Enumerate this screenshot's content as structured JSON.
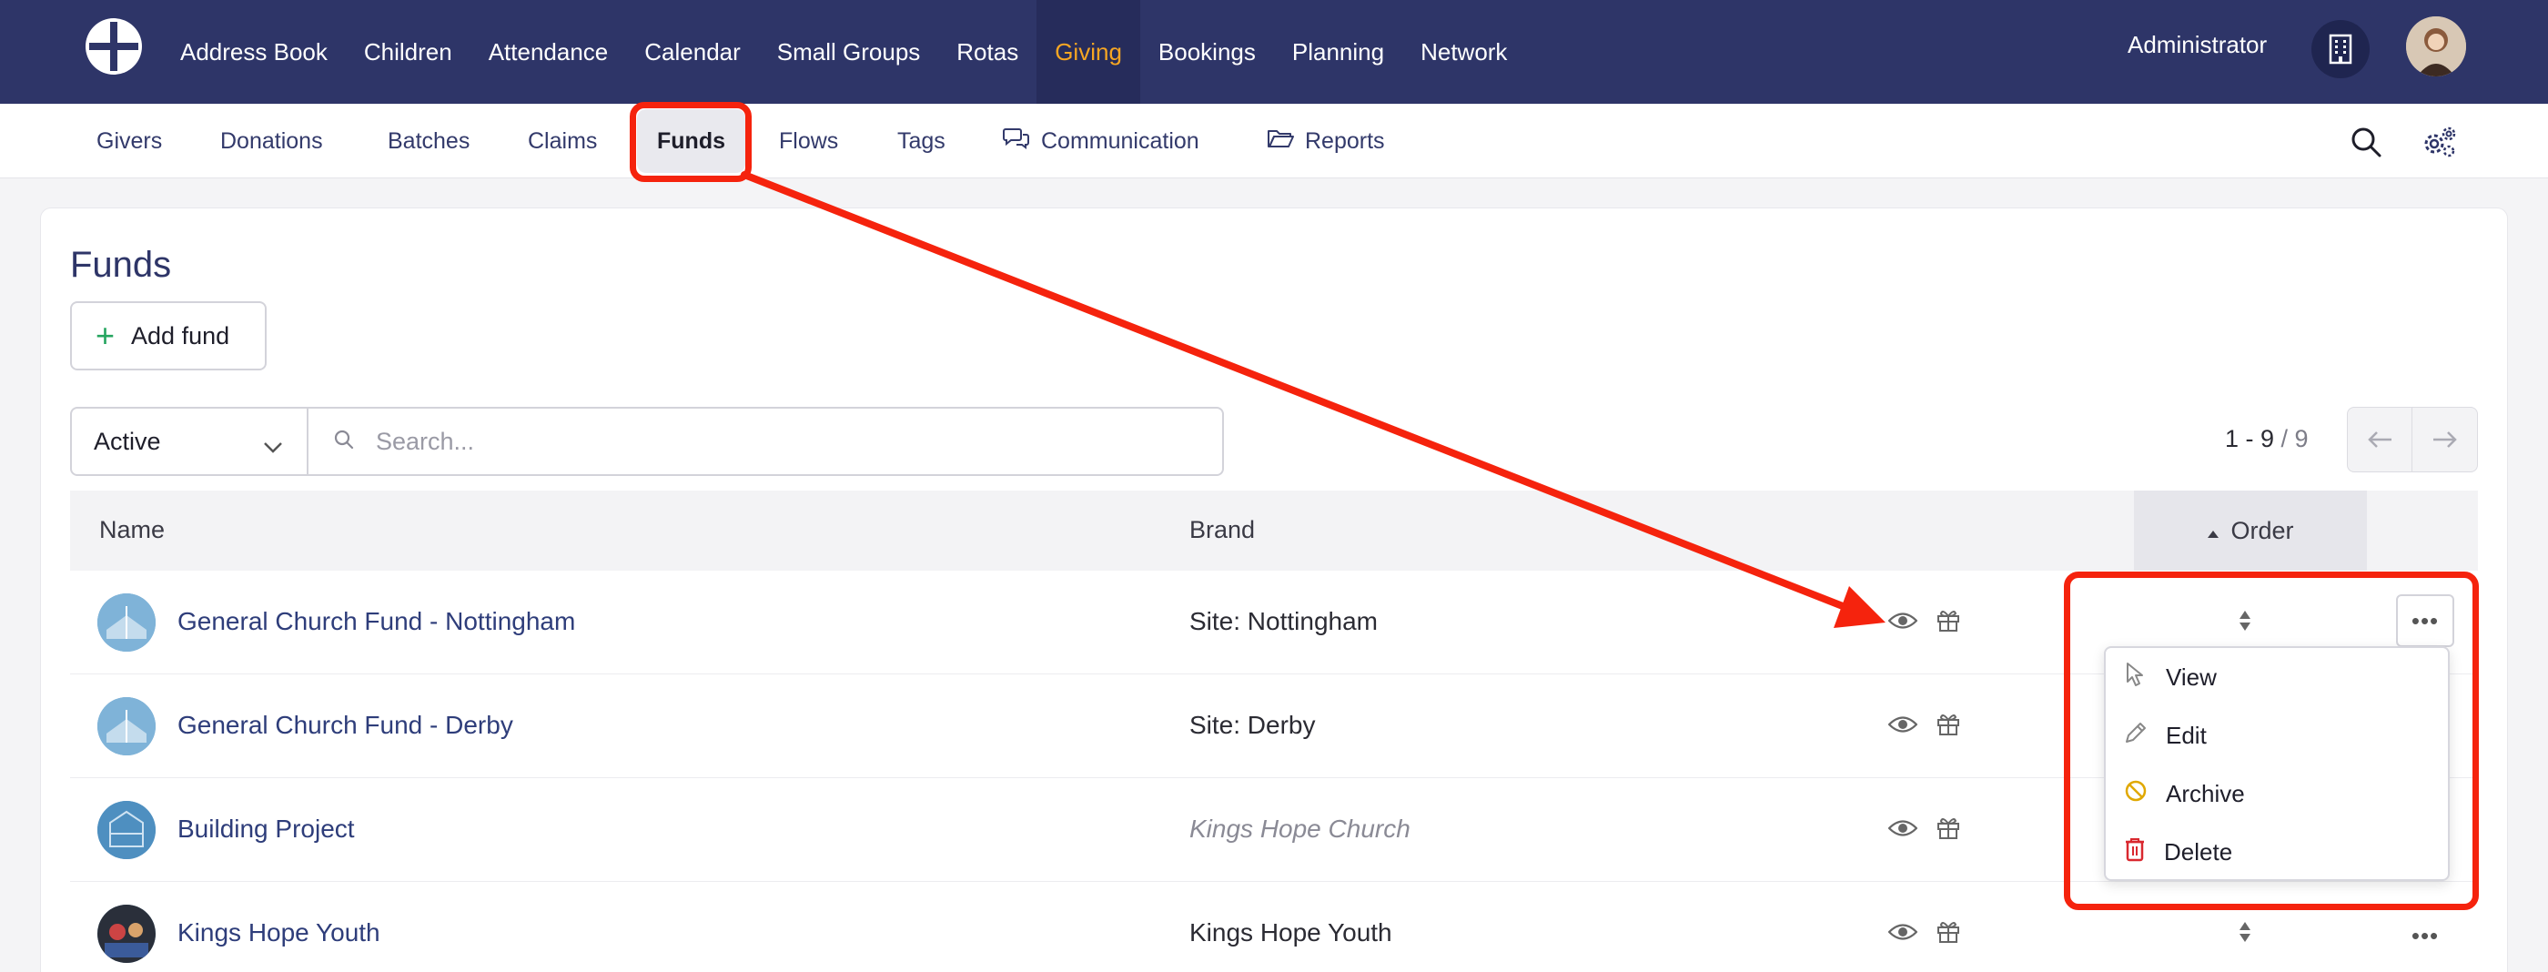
{
  "topnav": {
    "items": [
      {
        "label": "Address Book"
      },
      {
        "label": "Children"
      },
      {
        "label": "Attendance"
      },
      {
        "label": "Calendar"
      },
      {
        "label": "Small Groups"
      },
      {
        "label": "Rotas"
      },
      {
        "label": "Giving",
        "active": true
      },
      {
        "label": "Bookings"
      },
      {
        "label": "Planning"
      },
      {
        "label": "Network"
      }
    ],
    "user_name": "Administrator",
    "icons": {
      "logo": "church-logo-icon",
      "building": "building-icon",
      "avatar": "user-avatar"
    }
  },
  "subnav": {
    "items": [
      {
        "label": "Givers"
      },
      {
        "label": "Donations"
      },
      {
        "label": "Batches"
      },
      {
        "label": "Claims"
      },
      {
        "label": "Funds",
        "active": true
      },
      {
        "label": "Flows"
      },
      {
        "label": "Tags"
      },
      {
        "label": "Communication",
        "icon": "chat-bubbles-icon"
      },
      {
        "label": "Reports",
        "icon": "folder-open-icon"
      }
    ],
    "right_icons": [
      "search-icon",
      "settings-gears-icon"
    ]
  },
  "page": {
    "title": "Funds",
    "add_button": "Add fund",
    "status_filter": "Active",
    "search_placeholder": "Search...",
    "pager": {
      "range": "1 - 9",
      "total": "/ 9"
    }
  },
  "table": {
    "headers": {
      "name": "Name",
      "brand": "Brand",
      "order": "Order"
    },
    "rows": [
      {
        "name": "General Church Fund - Nottingham",
        "brand": "Site: Nottingham",
        "brand_inherited": false
      },
      {
        "name": "General Church Fund - Derby",
        "brand": "Site: Derby",
        "brand_inherited": false
      },
      {
        "name": "Building Project",
        "brand": "Kings Hope Church",
        "brand_inherited": true
      },
      {
        "name": "Kings Hope Youth",
        "brand": "Kings Hope Youth",
        "brand_inherited": false
      }
    ]
  },
  "row_menu": {
    "items": [
      {
        "label": "View",
        "icon": "cursor-pointer-icon"
      },
      {
        "label": "Edit",
        "icon": "pencil-icon"
      },
      {
        "label": "Archive",
        "icon": "ban-icon"
      },
      {
        "label": "Delete",
        "icon": "trash-icon"
      }
    ]
  },
  "colors": {
    "nav_bg": "#2e3568",
    "active_nav": "#f6a623",
    "link": "#2e3d7a",
    "highlight": "#f5230d",
    "add_green": "#25a55f",
    "archive_amber": "#e0a800",
    "delete_red": "#d9282f"
  }
}
